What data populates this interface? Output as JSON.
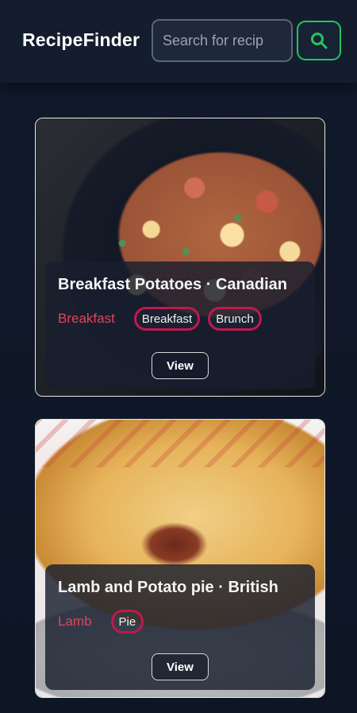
{
  "header": {
    "brand": "RecipeFinder",
    "search_placeholder": "Search for recip",
    "search_icon": "search-icon",
    "accent": "#23c65e"
  },
  "recipes": [
    {
      "title": "Breakfast Potatoes · Canadian",
      "category": "Breakfast",
      "tags": [
        "Breakfast",
        "Brunch"
      ],
      "view_label": "View"
    },
    {
      "title": "Lamb and Potato pie · British",
      "category": "Lamb",
      "tags": [
        "Pie"
      ],
      "view_label": "View"
    }
  ],
  "colors": {
    "category_text": "#e0455c",
    "tag_border": "#c2184d"
  }
}
